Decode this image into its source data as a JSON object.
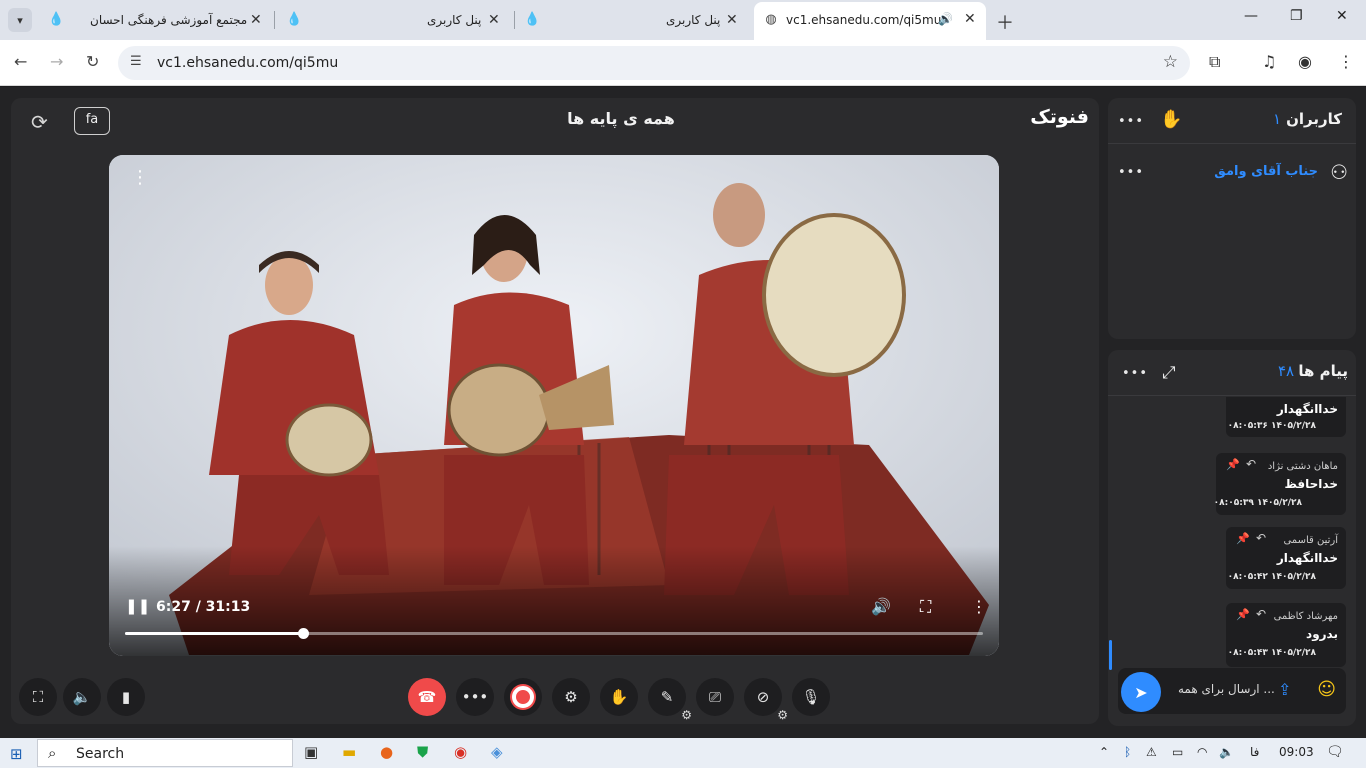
{
  "browser": {
    "tabs": [
      {
        "title": "مجتمع آموزشی فرهنگی احسان",
        "active": false
      },
      {
        "title": "پنل کاربری",
        "active": false
      },
      {
        "title": "پنل کاربری",
        "active": false
      },
      {
        "title": "vc1.ehsanedu.com/qi5mu",
        "active": true
      }
    ],
    "url": "vc1.ehsanedu.com/qi5mu"
  },
  "room": {
    "lang_button": "fa",
    "title": "همه ی پایه ها",
    "brand": "فنوتک"
  },
  "video": {
    "time_label": "6:27 / 31:13",
    "progress_fraction": 0.207
  },
  "users": {
    "title": "کاربران",
    "count": "۱",
    "list": [
      {
        "name": "جناب آقای وامق"
      }
    ]
  },
  "chat": {
    "title": "پیام ها",
    "count": "۴۸",
    "messages": [
      {
        "sender": "",
        "text": "خداانگهدار",
        "time": "۰۸:۰۵:۳۶ ۱۴۰۵/۲/۲۸"
      },
      {
        "sender": "ماهان دشتی نژاد",
        "text": "خداحافظ",
        "time": "۰۸:۰۵:۳۹ ۱۴۰۵/۲/۲۸"
      },
      {
        "sender": "آرتین قاسمی",
        "text": "خداانگهدار",
        "time": "۰۸:۰۵:۴۲ ۱۴۰۵/۲/۲۸"
      },
      {
        "sender": "مهرشاد کاظمی",
        "text": "بدرود",
        "time": "۰۸:۰۵:۴۳ ۱۴۰۵/۲/۲۸"
      }
    ],
    "input_placeholder": "ارسال برای همه ..."
  },
  "taskbar": {
    "search_placeholder": "Search",
    "lang": "فا",
    "clock": "09:03"
  },
  "colors": {
    "accent": "#2f8cff",
    "danger": "#f04a4a",
    "panel": "#2b2b2d"
  }
}
